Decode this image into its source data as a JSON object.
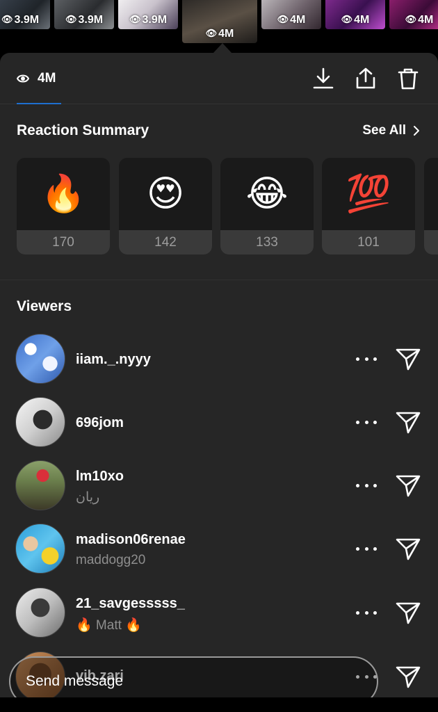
{
  "story_strip": {
    "thumbnails": [
      {
        "views": "3.9M"
      },
      {
        "views": "3.9M"
      },
      {
        "views": "3.9M"
      },
      {
        "views": "4M",
        "selected": true
      },
      {
        "views": "4M"
      },
      {
        "views": "4M"
      },
      {
        "views": "4M"
      }
    ]
  },
  "stats": {
    "views": "4M",
    "icons": [
      "eye-icon",
      "download-icon",
      "share-icon",
      "trash-icon"
    ]
  },
  "reaction_summary": {
    "title": "Reaction Summary",
    "see_all": "See All",
    "reactions": [
      {
        "emoji": "🔥",
        "name": "fire",
        "count": "170"
      },
      {
        "emoji": "😍",
        "name": "heart-eyes",
        "count": "142"
      },
      {
        "emoji": "😂",
        "name": "tears-of-joy",
        "count": "133"
      },
      {
        "emoji": "💯",
        "name": "hundred-points",
        "count": "101"
      }
    ]
  },
  "viewers": {
    "title": "Viewers",
    "list": [
      {
        "username": "iiam._.nyyy",
        "subtitle": ""
      },
      {
        "username": "696jom",
        "subtitle": ""
      },
      {
        "username": "lm10xo",
        "subtitle": "ريان"
      },
      {
        "username": "madison06renae",
        "subtitle": "maddogg20"
      },
      {
        "username": "21_savgesssss_",
        "subtitle": "🔥 Matt 🔥"
      },
      {
        "username": "vib.zari",
        "subtitle": ""
      }
    ]
  },
  "message_bar": {
    "placeholder": "Send message"
  },
  "colors": {
    "panel": "#262626",
    "tab_underline": "#1e6fd0",
    "secondary_text": "#8e8e8e"
  }
}
